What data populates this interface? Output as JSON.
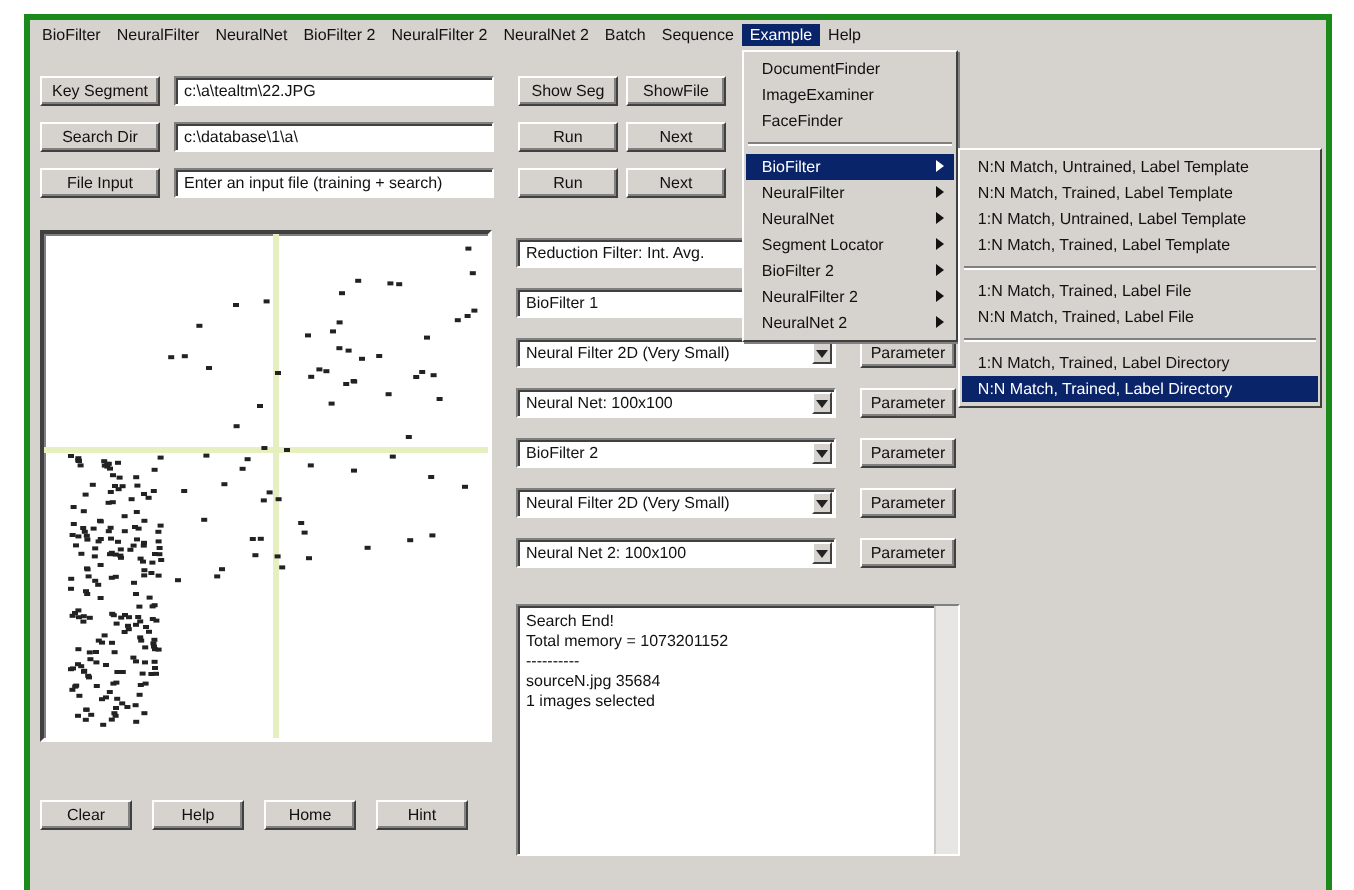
{
  "menubar": [
    {
      "label": "BioFilter",
      "selected": false
    },
    {
      "label": "NeuralFilter",
      "selected": false
    },
    {
      "label": "NeuralNet",
      "selected": false
    },
    {
      "label": "BioFilter 2",
      "selected": false
    },
    {
      "label": "NeuralFilter 2",
      "selected": false
    },
    {
      "label": "NeuralNet 2",
      "selected": false
    },
    {
      "label": "Batch",
      "selected": false
    },
    {
      "label": "Sequence",
      "selected": false
    },
    {
      "label": "Example",
      "selected": true
    },
    {
      "label": "Help",
      "selected": false
    }
  ],
  "example_menu": {
    "groups": [
      [
        {
          "label": "DocumentFinder",
          "submenu": false,
          "selected": false
        },
        {
          "label": "ImageExaminer",
          "submenu": false,
          "selected": false
        },
        {
          "label": "FaceFinder",
          "submenu": false,
          "selected": false
        }
      ],
      [
        {
          "label": "BioFilter",
          "submenu": true,
          "selected": true
        },
        {
          "label": "NeuralFilter",
          "submenu": true,
          "selected": false
        },
        {
          "label": "NeuralNet",
          "submenu": true,
          "selected": false
        },
        {
          "label": "Segment Locator",
          "submenu": true,
          "selected": false
        },
        {
          "label": "BioFilter 2",
          "submenu": true,
          "selected": false
        },
        {
          "label": "NeuralFilter 2",
          "submenu": true,
          "selected": false
        },
        {
          "label": "NeuralNet 2",
          "submenu": true,
          "selected": false
        }
      ]
    ]
  },
  "submenu": {
    "groups": [
      [
        {
          "label": "N:N Match, Untrained, Label Template",
          "selected": false
        },
        {
          "label": "N:N Match, Trained, Label Template",
          "selected": false
        },
        {
          "label": "1:N Match, Untrained, Label Template",
          "selected": false
        },
        {
          "label": "1:N Match, Trained, Label Template",
          "selected": false
        }
      ],
      [
        {
          "label": "1:N Match, Trained, Label File",
          "selected": false
        },
        {
          "label": "N:N Match, Trained, Label File",
          "selected": false
        }
      ],
      [
        {
          "label": "1:N Match, Trained, Label Directory",
          "selected": false
        },
        {
          "label": "N:N Match, Trained, Label Directory",
          "selected": true
        }
      ]
    ]
  },
  "input_rows": [
    {
      "button": "Key Segment",
      "value": "c:\\a\\tealtm\\22.JPG",
      "actions": [
        "Show Seg",
        "ShowFile"
      ]
    },
    {
      "button": "Search Dir",
      "value": "c:\\database\\1\\a\\",
      "actions": [
        "Run",
        "Next"
      ]
    },
    {
      "button": "File Input",
      "value": "Enter an input file (training + search)",
      "actions": [
        "Run",
        "Next"
      ]
    }
  ],
  "filter_fields": [
    "Reduction Filter: Int. Avg.",
    "BioFilter 1"
  ],
  "filter_combos": [
    {
      "value": "Neural Filter 2D (Very Small)",
      "button": "Parameter"
    },
    {
      "value": "Neural Net: 100x100",
      "button": "Parameter"
    },
    {
      "value": "BioFilter 2",
      "button": "Parameter"
    },
    {
      "value": "Neural Filter 2D (Very Small)",
      "button": "Parameter"
    },
    {
      "value": "Neural Net 2: 100x100",
      "button": "Parameter"
    }
  ],
  "output_lines": [
    "Search End!",
    "Total memory = 1073201152",
    "----------",
    "sourceN.jpg  35684",
    "1 images selected"
  ],
  "bottom_buttons": [
    "Clear",
    "Help",
    "Home",
    "Hint"
  ]
}
